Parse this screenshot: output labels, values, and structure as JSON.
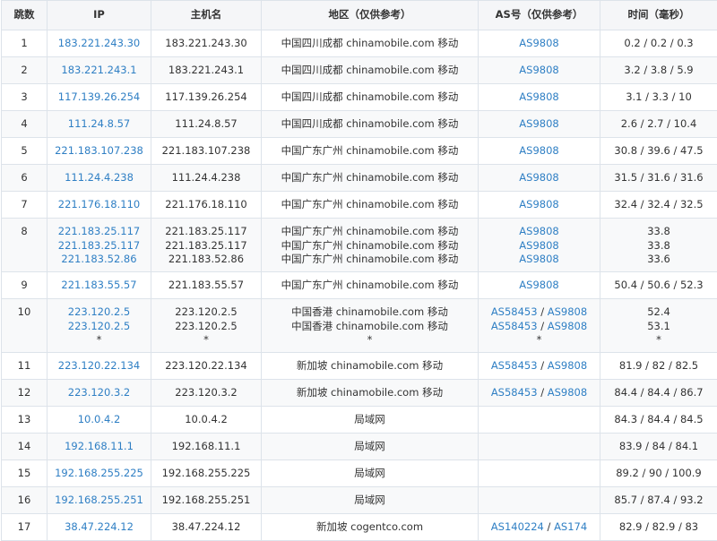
{
  "headers": {
    "hop": "跳数",
    "ip": "IP",
    "host": "主机名",
    "region": "地区（仅供参考）",
    "as": "AS号（仅供参考）",
    "time": "时间（毫秒）"
  },
  "accent_color": "#2f7fc4",
  "rows": [
    {
      "hop": "1",
      "ips": [
        "183.221.243.30"
      ],
      "hosts": [
        "183.221.243.30"
      ],
      "regions": [
        "中国四川成都 chinamobile.com 移动"
      ],
      "as": [
        [
          "AS9808"
        ]
      ],
      "times": [
        "0.2 / 0.2 / 0.3"
      ]
    },
    {
      "hop": "2",
      "ips": [
        "183.221.243.1"
      ],
      "hosts": [
        "183.221.243.1"
      ],
      "regions": [
        "中国四川成都 chinamobile.com 移动"
      ],
      "as": [
        [
          "AS9808"
        ]
      ],
      "times": [
        "3.2 / 3.8 / 5.9"
      ]
    },
    {
      "hop": "3",
      "ips": [
        "117.139.26.254"
      ],
      "hosts": [
        "117.139.26.254"
      ],
      "regions": [
        "中国四川成都 chinamobile.com 移动"
      ],
      "as": [
        [
          "AS9808"
        ]
      ],
      "times": [
        "3.1 / 3.3 / 10"
      ]
    },
    {
      "hop": "4",
      "ips": [
        "111.24.8.57"
      ],
      "hosts": [
        "111.24.8.57"
      ],
      "regions": [
        "中国四川成都 chinamobile.com 移动"
      ],
      "as": [
        [
          "AS9808"
        ]
      ],
      "times": [
        "2.6 / 2.7 / 10.4"
      ]
    },
    {
      "hop": "5",
      "ips": [
        "221.183.107.238"
      ],
      "hosts": [
        "221.183.107.238"
      ],
      "regions": [
        "中国广东广州 chinamobile.com 移动"
      ],
      "as": [
        [
          "AS9808"
        ]
      ],
      "times": [
        "30.8 / 39.6 / 47.5"
      ]
    },
    {
      "hop": "6",
      "ips": [
        "111.24.4.238"
      ],
      "hosts": [
        "111.24.4.238"
      ],
      "regions": [
        "中国广东广州 chinamobile.com 移动"
      ],
      "as": [
        [
          "AS9808"
        ]
      ],
      "times": [
        "31.5 / 31.6 / 31.6"
      ]
    },
    {
      "hop": "7",
      "ips": [
        "221.176.18.110"
      ],
      "hosts": [
        "221.176.18.110"
      ],
      "regions": [
        "中国广东广州 chinamobile.com 移动"
      ],
      "as": [
        [
          "AS9808"
        ]
      ],
      "times": [
        "32.4 / 32.4 / 32.5"
      ]
    },
    {
      "hop": "8",
      "ips": [
        "221.183.25.117",
        "221.183.25.117",
        "221.183.52.86"
      ],
      "hosts": [
        "221.183.25.117",
        "221.183.25.117",
        "221.183.52.86"
      ],
      "regions": [
        "中国广东广州 chinamobile.com 移动",
        "中国广东广州 chinamobile.com 移动",
        "中国广东广州 chinamobile.com 移动"
      ],
      "as": [
        [
          "AS9808"
        ],
        [
          "AS9808"
        ],
        [
          "AS9808"
        ]
      ],
      "times": [
        "33.8",
        "33.8",
        "33.6"
      ]
    },
    {
      "hop": "9",
      "ips": [
        "221.183.55.57"
      ],
      "hosts": [
        "221.183.55.57"
      ],
      "regions": [
        "中国广东广州 chinamobile.com 移动"
      ],
      "as": [
        [
          "AS9808"
        ]
      ],
      "times": [
        "50.4 / 50.6 / 52.3"
      ]
    },
    {
      "hop": "10",
      "ips": [
        "223.120.2.5",
        "223.120.2.5",
        "*"
      ],
      "hosts": [
        "223.120.2.5",
        "223.120.2.5",
        "*"
      ],
      "regions": [
        "中国香港 chinamobile.com 移动",
        "中国香港 chinamobile.com 移动",
        "*"
      ],
      "as": [
        [
          "AS58453",
          "AS9808"
        ],
        [
          "AS58453",
          "AS9808"
        ],
        [
          "*"
        ]
      ],
      "times": [
        "52.4",
        "53.1",
        "*"
      ]
    },
    {
      "hop": "11",
      "ips": [
        "223.120.22.134"
      ],
      "hosts": [
        "223.120.22.134"
      ],
      "regions": [
        "新加坡 chinamobile.com 移动"
      ],
      "as": [
        [
          "AS58453",
          "AS9808"
        ]
      ],
      "times": [
        "81.9 / 82 / 82.5"
      ]
    },
    {
      "hop": "12",
      "ips": [
        "223.120.3.2"
      ],
      "hosts": [
        "223.120.3.2"
      ],
      "regions": [
        "新加坡 chinamobile.com 移动"
      ],
      "as": [
        [
          "AS58453",
          "AS9808"
        ]
      ],
      "times": [
        "84.4 / 84.4 / 86.7"
      ]
    },
    {
      "hop": "13",
      "ips": [
        "10.0.4.2"
      ],
      "hosts": [
        "10.0.4.2"
      ],
      "regions": [
        "局域网"
      ],
      "as": [
        []
      ],
      "times": [
        "84.3 / 84.4 / 84.5"
      ]
    },
    {
      "hop": "14",
      "ips": [
        "192.168.11.1"
      ],
      "hosts": [
        "192.168.11.1"
      ],
      "regions": [
        "局域网"
      ],
      "as": [
        []
      ],
      "times": [
        "83.9 / 84 / 84.1"
      ]
    },
    {
      "hop": "15",
      "ips": [
        "192.168.255.225"
      ],
      "hosts": [
        "192.168.255.225"
      ],
      "regions": [
        "局域网"
      ],
      "as": [
        []
      ],
      "times": [
        "89.2 / 90 / 100.9"
      ]
    },
    {
      "hop": "16",
      "ips": [
        "192.168.255.251"
      ],
      "hosts": [
        "192.168.255.251"
      ],
      "regions": [
        "局域网"
      ],
      "as": [
        []
      ],
      "times": [
        "85.7 / 87.4 / 93.2"
      ]
    },
    {
      "hop": "17",
      "ips": [
        "38.47.224.12"
      ],
      "hosts": [
        "38.47.224.12"
      ],
      "regions": [
        "新加坡 cogentco.com"
      ],
      "as": [
        [
          "AS140224",
          "AS174"
        ]
      ],
      "times": [
        "82.9 / 82.9 / 83"
      ]
    }
  ]
}
